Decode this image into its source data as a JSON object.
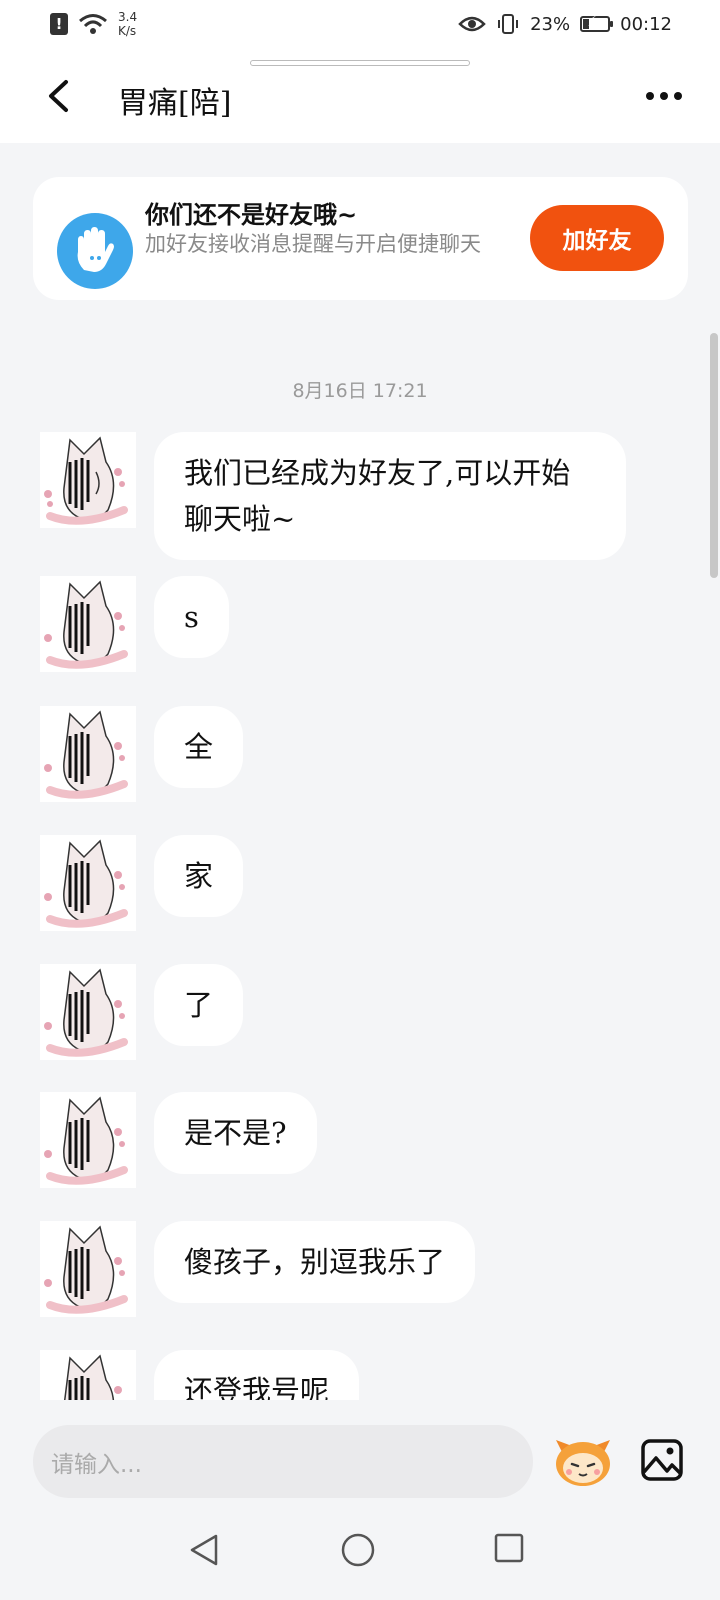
{
  "status_bar": {
    "speed_value": "3.4",
    "speed_unit": "K/s",
    "battery": "23%",
    "battery_level": 0.23,
    "time": "00:12"
  },
  "header": {
    "title": "胃痛[陪]"
  },
  "friend_card": {
    "title": "你们还不是好友哦~",
    "description": "加好友接收消息提醒与开启便捷聊天",
    "add_button": "加好友"
  },
  "chat": {
    "timestamp": "8月16日 17:21",
    "messages": [
      {
        "text": "我们已经成为好友了,可以开始聊天啦~"
      },
      {
        "text": "s"
      },
      {
        "text": "全"
      },
      {
        "text": "家"
      },
      {
        "text": "了"
      },
      {
        "text": "是不是?"
      },
      {
        "text": "傻孩子，别逗我乐了"
      },
      {
        "text": "还登我号呢"
      }
    ]
  },
  "input": {
    "placeholder": "请输入..."
  },
  "colors": {
    "accent": "#f1520f",
    "hand_icon_bg": "#3ea7ea",
    "background": "#f4f5f7"
  },
  "icons": [
    "alert-icon",
    "wifi-icon",
    "eye-icon",
    "vibrate-icon",
    "battery-icon",
    "back-arrow-icon",
    "more-icon",
    "hand-icon",
    "emoji-icon",
    "image-icon",
    "nav-back-icon",
    "nav-home-icon",
    "nav-recent-icon"
  ]
}
